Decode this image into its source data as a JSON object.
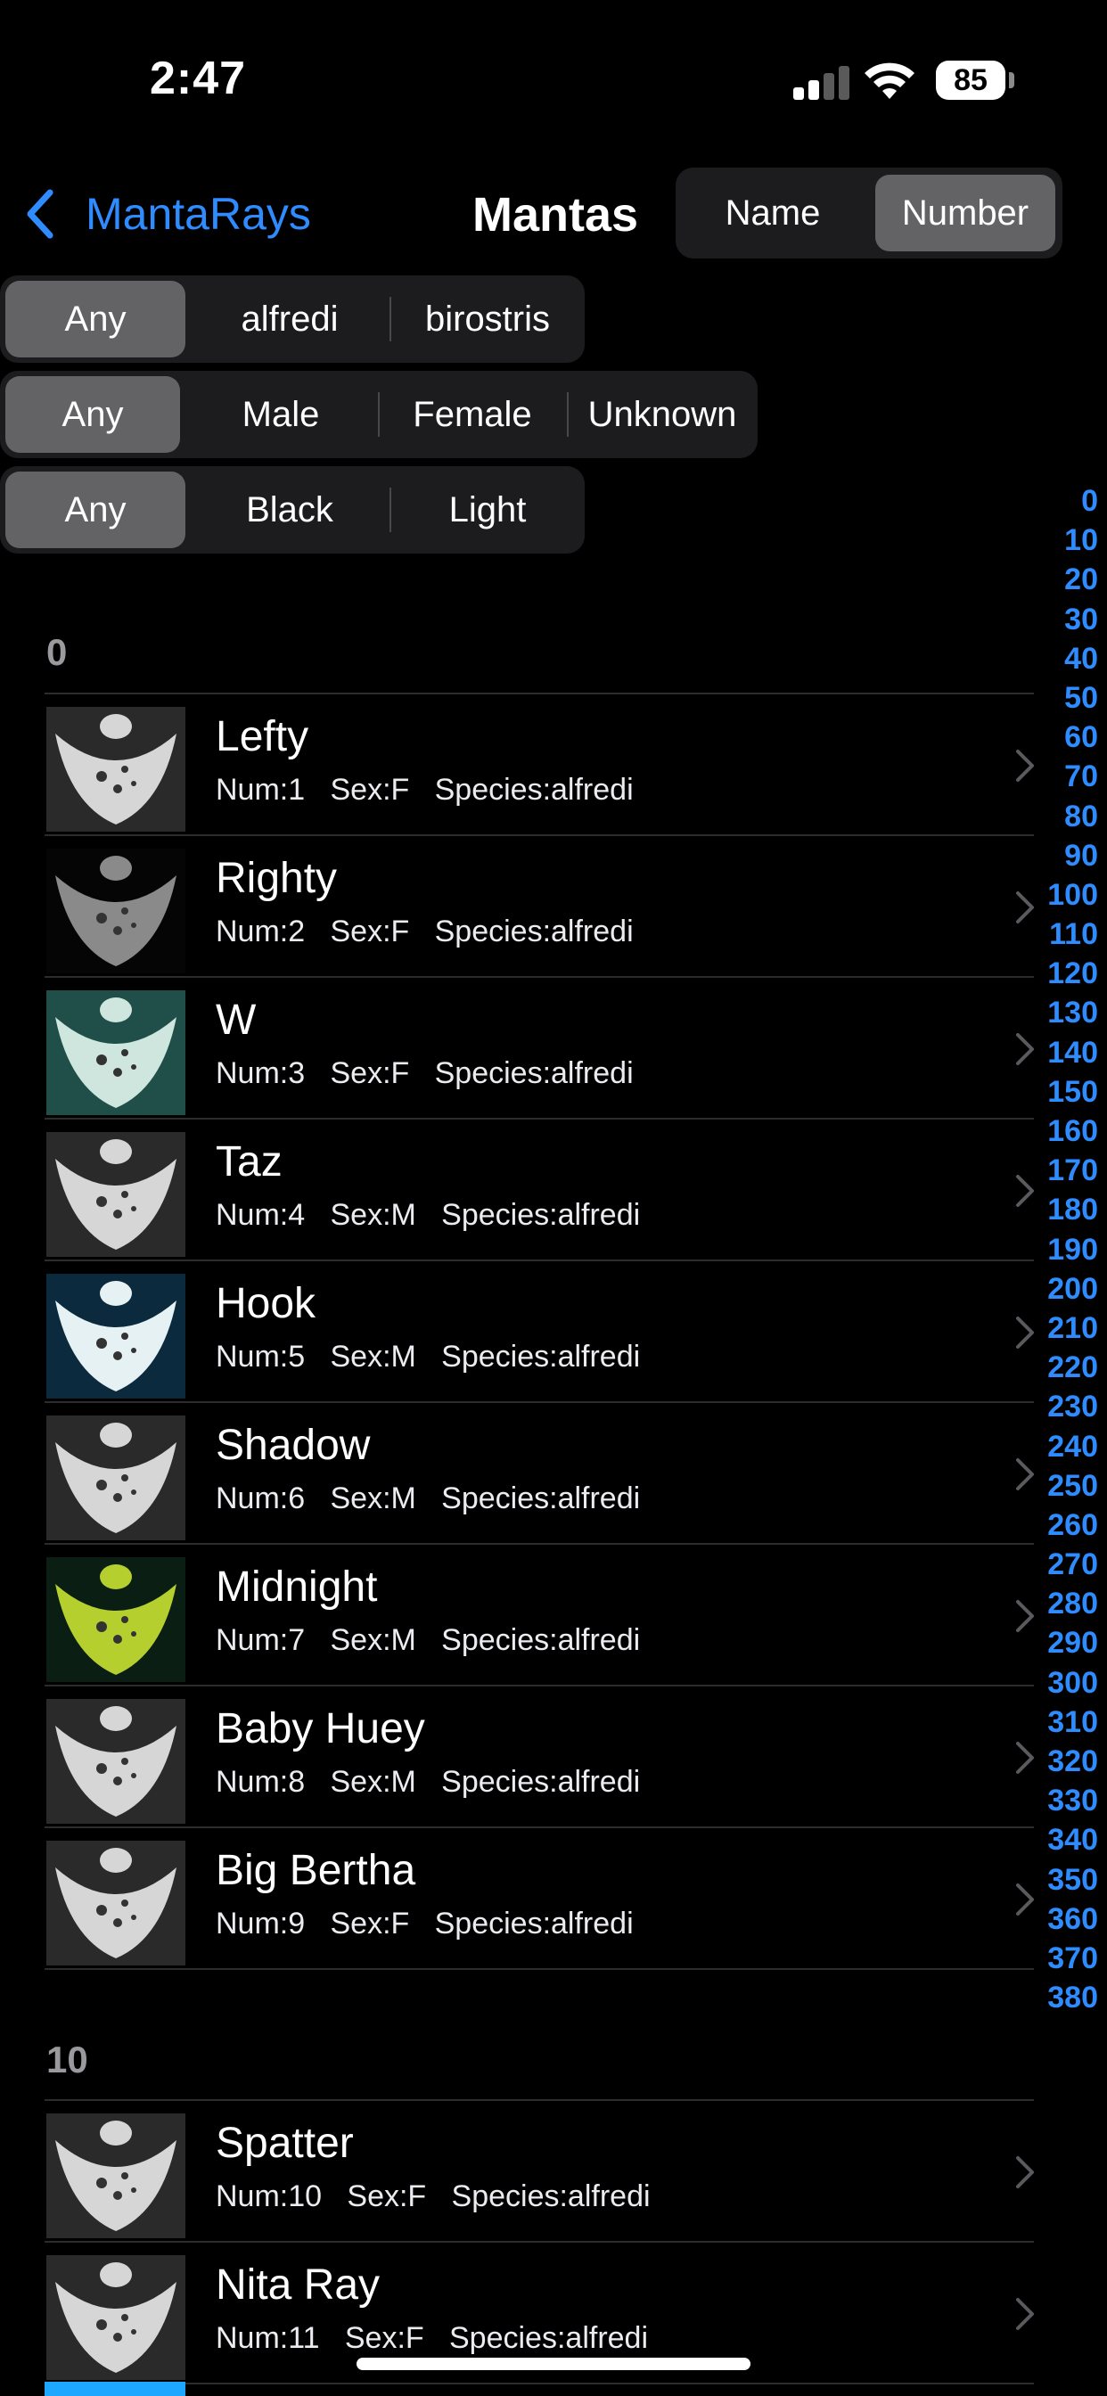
{
  "status": {
    "time": "2:47",
    "battery": "85"
  },
  "nav": {
    "back_label": "MantaRays",
    "title": "Mantas"
  },
  "sort": {
    "options": [
      "Name",
      "Number"
    ],
    "selected": "Number"
  },
  "filters": {
    "species": {
      "options": [
        "Any",
        "alfredi",
        "birostris"
      ],
      "selected": "Any"
    },
    "sex": {
      "options": [
        "Any",
        "Male",
        "Female",
        "Unknown"
      ],
      "selected": "Any"
    },
    "color": {
      "options": [
        "Any",
        "Black",
        "Light"
      ],
      "selected": "Any"
    }
  },
  "sections": [
    {
      "header": "0",
      "rows": [
        {
          "name": "Lefty",
          "detail": "Num:1   Sex:F   Species:alfredi",
          "thumb": "light"
        },
        {
          "name": "Righty",
          "detail": "Num:2   Sex:F   Species:alfredi",
          "thumb": "dark"
        },
        {
          "name": "W",
          "detail": "Num:3   Sex:F   Species:alfredi",
          "thumb": "teal"
        },
        {
          "name": "Taz",
          "detail": "Num:4   Sex:M   Species:alfredi",
          "thumb": "light"
        },
        {
          "name": "Hook",
          "detail": "Num:5   Sex:M   Species:alfredi",
          "thumb": "blue"
        },
        {
          "name": "Shadow",
          "detail": "Num:6   Sex:M   Species:alfredi",
          "thumb": "light"
        },
        {
          "name": "Midnight",
          "detail": "Num:7   Sex:M   Species:alfredi",
          "thumb": "green"
        },
        {
          "name": "Baby Huey",
          "detail": "Num:8   Sex:M   Species:alfredi",
          "thumb": "light"
        },
        {
          "name": "Big Bertha",
          "detail": "Num:9   Sex:F   Species:alfredi",
          "thumb": "light"
        }
      ]
    },
    {
      "header": "10",
      "rows": [
        {
          "name": "Spatter",
          "detail": "Num:10   Sex:F   Species:alfredi",
          "thumb": "light"
        },
        {
          "name": "Nita Ray",
          "detail": "Num:11   Sex:F   Species:alfredi",
          "thumb": "light"
        }
      ]
    }
  ],
  "index": [
    "0",
    "10",
    "20",
    "30",
    "40",
    "50",
    "60",
    "70",
    "80",
    "90",
    "100",
    "110",
    "120",
    "130",
    "140",
    "150",
    "160",
    "170",
    "180",
    "190",
    "200",
    "210",
    "220",
    "230",
    "240",
    "250",
    "260",
    "270",
    "280",
    "290",
    "300",
    "310",
    "320",
    "330",
    "340",
    "350",
    "360",
    "370",
    "380"
  ],
  "colors": {
    "accent": "#2f8cff",
    "segment_bg": "#1c1c1e",
    "segment_selected": "#636366"
  }
}
